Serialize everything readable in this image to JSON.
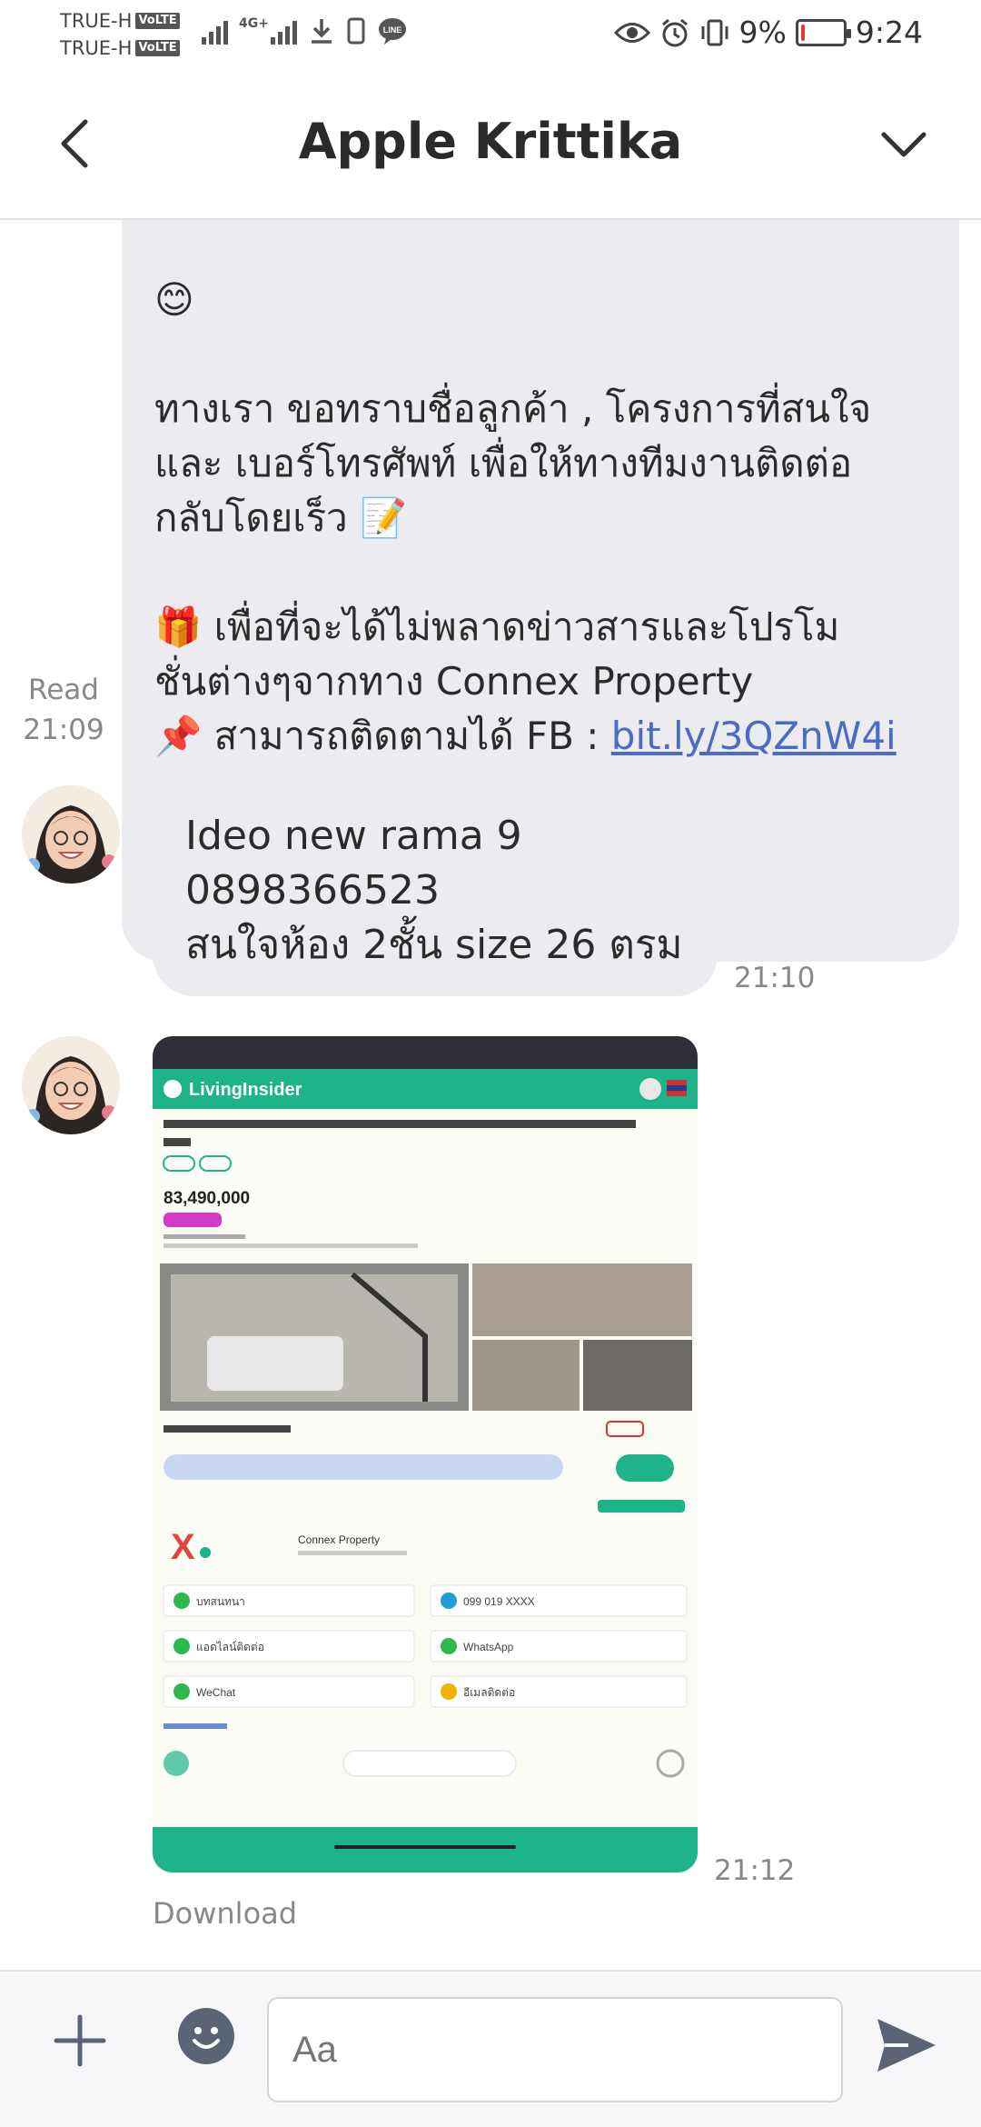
{
  "status_bar": {
    "carrier_1": "TRUE-H",
    "carrier_2": "TRUE-H",
    "volte": "VoLTE",
    "network": "4G+",
    "battery_percent": "9%",
    "battery_level": 0.09,
    "time": "9:24",
    "icons": [
      "signal-icon",
      "download-icon",
      "sim-icon",
      "line-icon",
      "eye-icon",
      "alarm-icon",
      "vibrate-icon",
      "battery-icon"
    ]
  },
  "header": {
    "title": "Apple Krittika",
    "back_icon": "chevron-left-icon",
    "menu_icon": "chevron-down-icon"
  },
  "messages": {
    "outgoing": {
      "lines": [
        "😊",
        "",
        "ทางเรา ขอทราบชื่อลูกค้า , โครงการที่สนใจ",
        "และ เบอร์โทรศัพท์ เพื่อให้ทางทีมงานติดต่อ",
        "กลับโดยเร็ว 📝",
        "",
        "🎁 เพื่อที่จะได้ไม่พลาดข่าวสารและโปรโม",
        "ชั่นต่างๆจากทาง Connex Property",
        "📌 สามารถติดตามได้ FB : "
      ],
      "link": "bit.ly/3QZnW4i",
      "read_label": "Read",
      "time": "21:09"
    },
    "incoming_text": {
      "line1": "Ideo new rama 9",
      "line2": "0898366523",
      "line3": "สนใจห้อง 2ชั้น size 26 ตรม",
      "time": "21:10"
    },
    "incoming_image": {
      "time": "21:12",
      "download_label": "Download",
      "screenshot": {
        "site": "LivingInsider",
        "price": "83,490,000",
        "agent": "Connex Property",
        "contacts": [
          "บทสนทนา",
          "099 019 XXXX",
          "แอดไลน์ติดต่อ",
          "WhatsApp",
          "WeChat",
          "อีเมลติดต่อ"
        ]
      }
    }
  },
  "input_bar": {
    "placeholder": "Aa",
    "plus_icon": "plus-icon",
    "emoji_icon": "emoji-icon",
    "send_icon": "send-icon"
  },
  "colors": {
    "bubble": "#ececf0",
    "link": "#4a6cc4",
    "accent_green": "#1fb38a"
  }
}
